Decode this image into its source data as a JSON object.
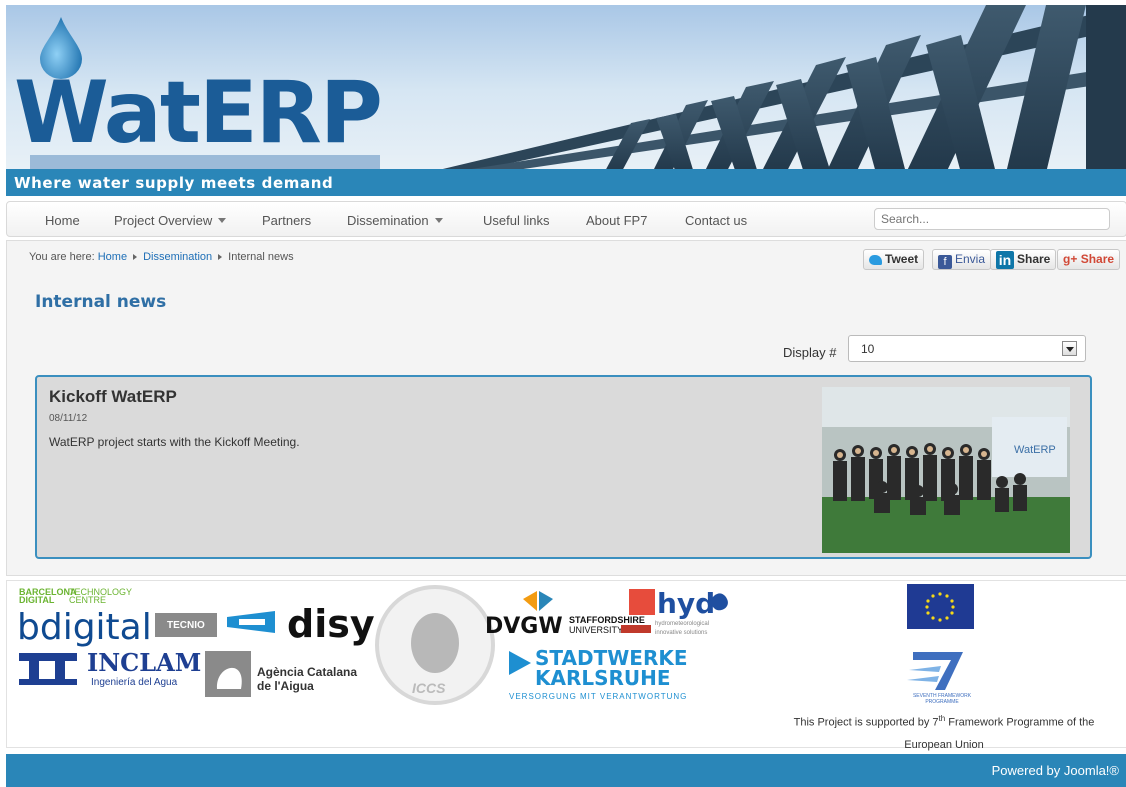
{
  "header": {
    "logo_text": "WatERP",
    "tagline": "Where water supply meets demand"
  },
  "nav": {
    "items": [
      {
        "label": "Home"
      },
      {
        "label": "Project Overview",
        "dropdown": true
      },
      {
        "label": "Partners"
      },
      {
        "label": "Dissemination",
        "dropdown": true
      },
      {
        "label": "Useful links"
      },
      {
        "label": "About FP7"
      },
      {
        "label": "Contact us"
      }
    ],
    "search_placeholder": "Search..."
  },
  "breadcrumb": {
    "prefix": "You are here:",
    "items": [
      "Home",
      "Dissemination",
      "Internal news"
    ]
  },
  "social": {
    "tweet": "Tweet",
    "facebook": "Envia",
    "linkedin": "Share",
    "gplus": "Share"
  },
  "main": {
    "title": "Internal news",
    "display_label": "Display #",
    "display_value": "10"
  },
  "article": {
    "title": "Kickoff WatERP",
    "date": "08/11/12",
    "body": "WatERP project starts with the Kickoff Meeting.",
    "photo_text": "WatERP"
  },
  "partners": {
    "barcelona": "BARCELONA",
    "tech": "TECHNOLOGY",
    "digital": "DIGITAL",
    "centre": "CENTRE",
    "bdigital": "bdigital",
    "tecnio": "TECNIO",
    "disy": "disy",
    "dvgw": "DVGW",
    "staffordshire": "STAFFORDSHIRE",
    "university": "UNIVERSITY",
    "hydro": "hydrometeorological",
    "innovative": "innovative solutions",
    "inclam": "INCLAM",
    "inclam_sub": "Ingeniería del Agua",
    "aca_line1": "Agència Catalana",
    "aca_line2": "de l'Aigua",
    "iccs": "ICCS",
    "stadtwerke": "STADTWERKE",
    "karlsruhe": "KARLSRUHE",
    "sw_tagline": "VERSORGUNG MIT VERANTWORTUNG",
    "hydus": "hyd",
    "fp7_caption": "SEVENTH FRAMEWORK",
    "fp7_caption2": "PROGRAMME"
  },
  "footer": {
    "note_pre": "This Project is supported by 7",
    "note_sup": "th",
    "note_post": " Framework Programme of the European Union",
    "powered": "Powered by Joomla!®"
  },
  "colors": {
    "brand_blue": "#2a86b8",
    "title_blue": "#2f6fa5",
    "logo_blue": "#1b5c97"
  }
}
